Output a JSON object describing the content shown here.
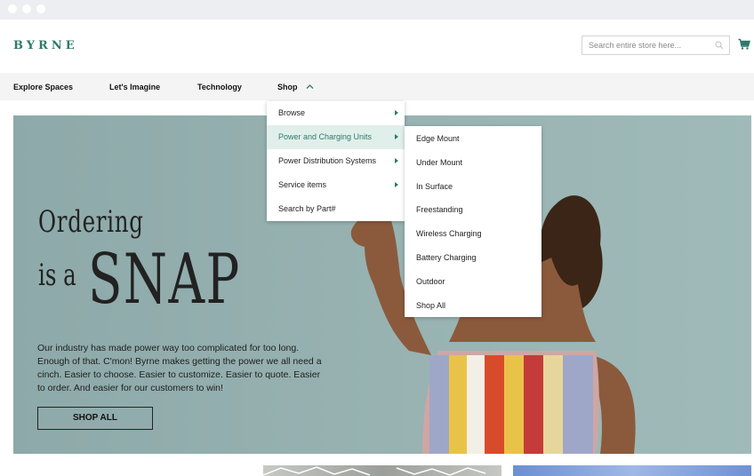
{
  "brand": {
    "logo": "BYRNE",
    "accent_color": "#2f7a6a"
  },
  "search": {
    "placeholder": "Search entire store here..."
  },
  "icons": {
    "search": "search-icon",
    "cart": "cart-icon",
    "submenu_arrow": "caret-right-icon",
    "shop_toggle": "chevron-up-icon"
  },
  "nav": {
    "items": [
      {
        "label": "Explore Spaces"
      },
      {
        "label": "Let's Imagine"
      },
      {
        "label": "Technology"
      },
      {
        "label": "Shop"
      }
    ]
  },
  "shop_menu": {
    "items": [
      {
        "label": "Browse",
        "has_submenu": true
      },
      {
        "label": "Power and Charging Units",
        "has_submenu": true,
        "active": true
      },
      {
        "label": "Power Distribution Systems",
        "has_submenu": true
      },
      {
        "label": "Service items",
        "has_submenu": true
      },
      {
        "label": "Search by Part#",
        "has_submenu": false
      }
    ],
    "active_bg": "#e1efeb"
  },
  "power_submenu": {
    "items": [
      {
        "label": "Edge Mount"
      },
      {
        "label": "Under Mount"
      },
      {
        "label": "In Surface"
      },
      {
        "label": "Freestanding"
      },
      {
        "label": "Wireless Charging"
      },
      {
        "label": "Battery Charging"
      },
      {
        "label": "Outdoor"
      },
      {
        "label": "Shop All"
      }
    ]
  },
  "hero": {
    "title_line1": "Ordering",
    "title_line2": "is a",
    "title_line3": "SNAP",
    "description": "Our industry has made power way too complicated for too long. Enough of that. C'mon! Byrne makes getting the power we all need a cinch. Easier to choose. Easier to customize. Easier to quote. Easier to order. And easier for our customers to win!",
    "cta_label": "SHOP ALL",
    "background_color": "#98b3b2"
  }
}
